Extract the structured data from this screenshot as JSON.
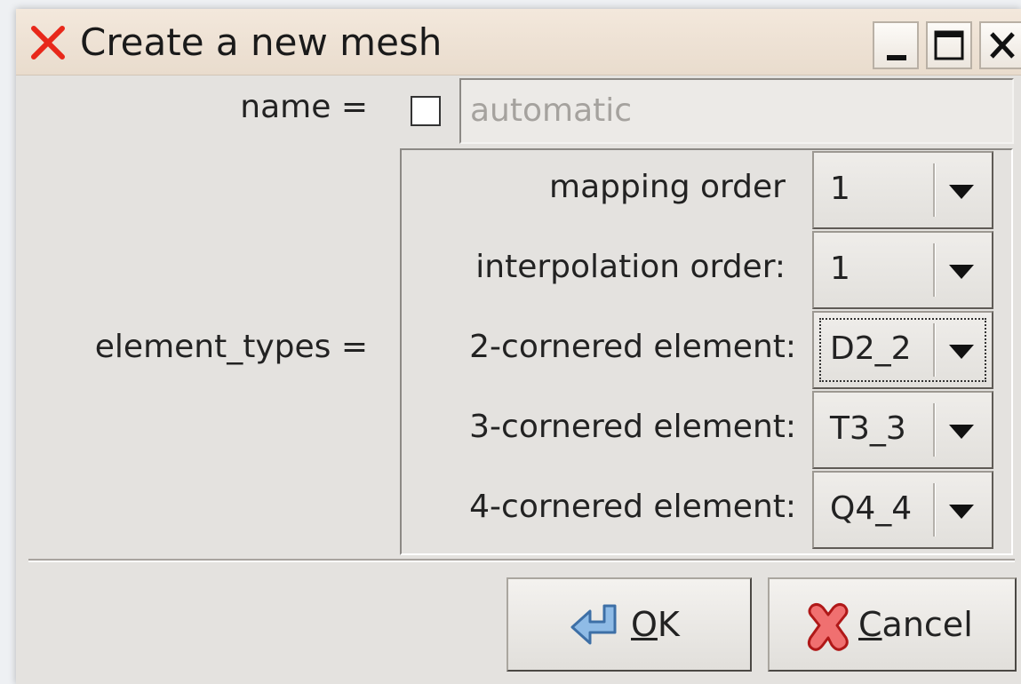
{
  "window": {
    "title": "Create a new mesh",
    "icon": "close-x-icon",
    "controls": [
      "minimize-icon",
      "maximize-icon",
      "close-icon"
    ]
  },
  "form": {
    "name_label": "name =",
    "name_checkbox_checked": false,
    "name_placeholder": "automatic",
    "element_types_label": "element_types =",
    "rows": [
      {
        "label": "mapping order",
        "value": "1"
      },
      {
        "label": "interpolation order:",
        "value": "1"
      },
      {
        "label": "2-cornered element:",
        "value": "D2_2"
      },
      {
        "label": "3-cornered element:",
        "value": "T3_3"
      },
      {
        "label": "4-cornered element:",
        "value": "Q4_4"
      }
    ]
  },
  "buttons": {
    "ok_label": "OK",
    "ok_icon": "return-arrow-icon",
    "cancel_label": "Cancel",
    "cancel_icon": "red-x-icon"
  },
  "colors": {
    "dialog_bg": "#e4e2df",
    "titlebar_bg": "#ece0d2",
    "close_accent": "#e8281a",
    "ok_icon_blue": "#6fa6dc"
  }
}
